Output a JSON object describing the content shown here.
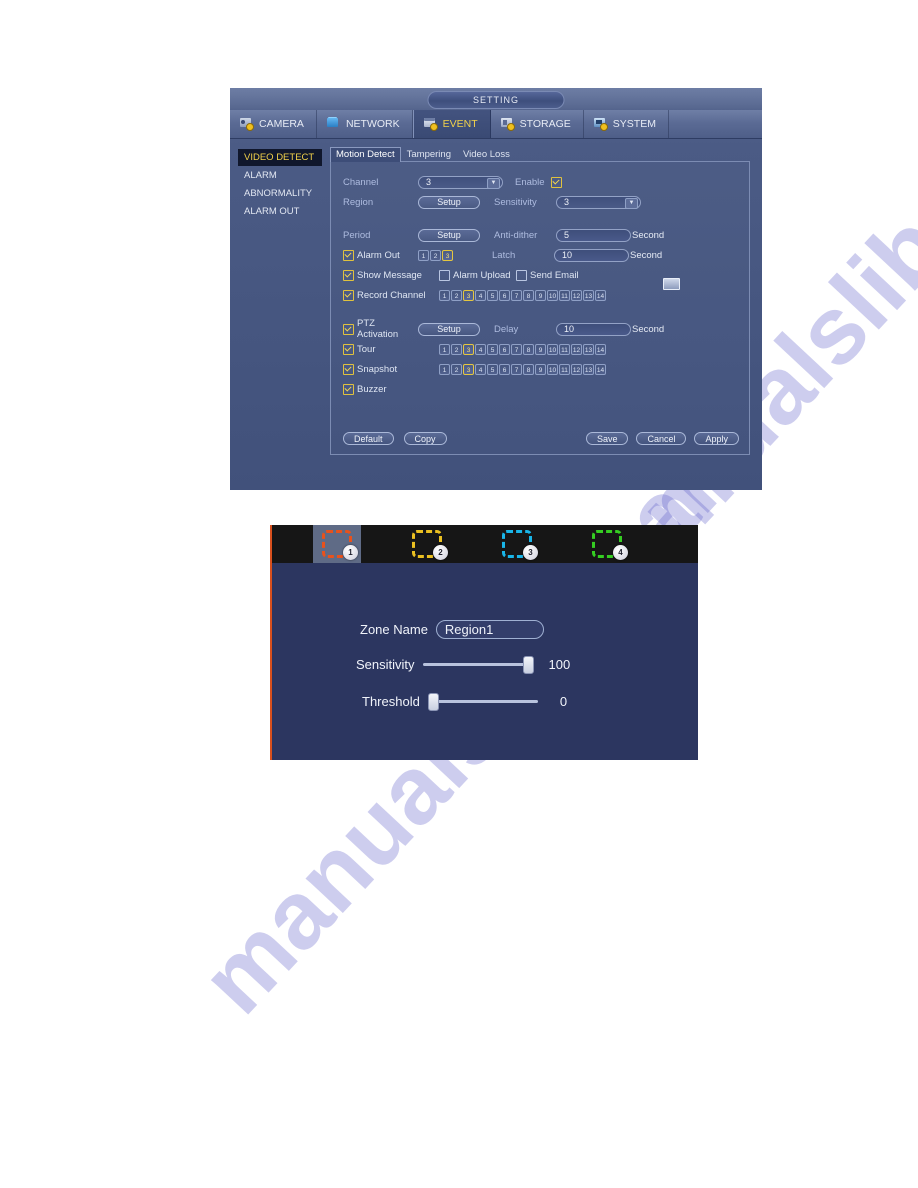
{
  "watermark": {
    "line1": "manualslib.com",
    "line2": "manualslib.com"
  },
  "setting_window": {
    "title": "SETTING",
    "top_tabs": [
      {
        "label": "CAMERA",
        "icon": "camera-icon",
        "active": false
      },
      {
        "label": "NETWORK",
        "icon": "network-icon",
        "active": false
      },
      {
        "label": "EVENT",
        "icon": "event-icon",
        "active": true
      },
      {
        "label": "STORAGE",
        "icon": "storage-icon",
        "active": false
      },
      {
        "label": "SYSTEM",
        "icon": "system-icon",
        "active": false
      }
    ],
    "sidebar": [
      {
        "label": "VIDEO DETECT",
        "active": true
      },
      {
        "label": "ALARM",
        "active": false
      },
      {
        "label": "ABNORMALITY",
        "active": false
      },
      {
        "label": "ALARM OUT",
        "active": false
      }
    ],
    "sub_tabs": [
      {
        "label": "Motion Detect",
        "active": true
      },
      {
        "label": "Tampering",
        "active": false
      },
      {
        "label": "Video Loss",
        "active": false
      }
    ],
    "form": {
      "channel_label": "Channel",
      "channel_value": "3",
      "enable_label": "Enable",
      "enable_checked": true,
      "region_label": "Region",
      "region_button": "Setup",
      "sensitivity_label": "Sensitivity",
      "sensitivity_value": "3",
      "period_label": "Period",
      "period_button": "Setup",
      "antidither_label": "Anti-dither",
      "antidither_value": "5",
      "antidither_unit": "Second",
      "alarm_out_label": "Alarm Out",
      "alarm_out_checked": true,
      "alarm_out_channels": [
        "1",
        "2",
        "3"
      ],
      "alarm_out_selected": [
        "3"
      ],
      "latch_label": "Latch",
      "latch_value": "10",
      "latch_unit": "Second",
      "show_message_label": "Show Message",
      "show_message_checked": true,
      "alarm_upload_label": "Alarm Upload",
      "alarm_upload_checked": false,
      "send_email_label": "Send Email",
      "send_email_checked": false,
      "record_channel_label": "Record Channel",
      "record_channel_checked": true,
      "record_channels": [
        "1",
        "2",
        "3",
        "4",
        "5",
        "6",
        "7",
        "8",
        "9",
        "10",
        "11",
        "12",
        "13",
        "14"
      ],
      "record_selected": [
        "3"
      ],
      "ptz_label": "PTZ Activation",
      "ptz_checked": true,
      "ptz_button": "Setup",
      "delay_label": "Delay",
      "delay_value": "10",
      "delay_unit": "Second",
      "tour_label": "Tour",
      "tour_checked": true,
      "tour_channels": [
        "1",
        "2",
        "3",
        "4",
        "5",
        "6",
        "7",
        "8",
        "9",
        "10",
        "11",
        "12",
        "13",
        "14"
      ],
      "tour_selected": [
        "3"
      ],
      "snapshot_label": "Snapshot",
      "snapshot_checked": true,
      "snapshot_channels": [
        "1",
        "2",
        "3",
        "4",
        "5",
        "6",
        "7",
        "8",
        "9",
        "10",
        "11",
        "12",
        "13",
        "14"
      ],
      "snapshot_selected": [
        "3"
      ],
      "buzzer_label": "Buzzer",
      "buzzer_checked": true
    },
    "buttons": {
      "default": "Default",
      "copy": "Copy",
      "save": "Save",
      "cancel": "Cancel",
      "apply": "Apply"
    }
  },
  "region_dialog": {
    "zones": [
      {
        "number": "1",
        "color": "#e8521c",
        "active": true
      },
      {
        "number": "2",
        "color": "#ebc021",
        "active": false
      },
      {
        "number": "3",
        "color": "#19b5e8",
        "active": false
      },
      {
        "number": "4",
        "color": "#35cd22",
        "active": false
      }
    ],
    "zone_name_label": "Zone Name",
    "zone_name_value": "Region1",
    "sensitivity_label": "Sensitivity",
    "sensitivity_value": "100",
    "sensitivity_percent": 100,
    "threshold_label": "Threshold",
    "threshold_value": "0",
    "threshold_percent": 0
  },
  "colors": {
    "accent_yellow": "#f2d24a",
    "panel_blue": "#41517b",
    "dialog_blue": "#2c3660",
    "zone_bar_black": "#161616"
  }
}
